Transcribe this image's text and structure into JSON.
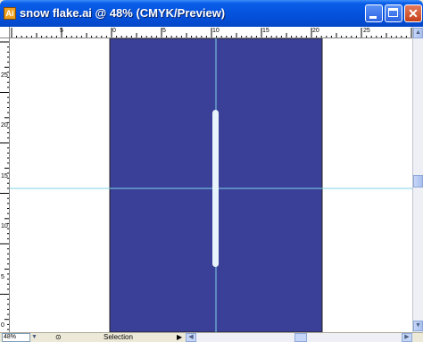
{
  "window": {
    "title": "snow flake.ai @ 48% (CMYK/Preview)",
    "app_icon_glyph": "Ai",
    "title_color": "#ffffff",
    "titlebar_color": "#0553df"
  },
  "rulers": {
    "horizontal_labels": [
      "5",
      "0",
      "5",
      "10",
      "15",
      "20",
      "25"
    ],
    "vertical_labels": [
      "25",
      "20",
      "15",
      "10",
      "5",
      "0"
    ]
  },
  "artboard": {
    "background_color": "#3a3f98",
    "guide_color": "#7fd3e6",
    "stroke_color": "#e8f4fb"
  },
  "statusbar": {
    "zoom_value": "48%",
    "zoom_arrow_icon": "chevron-down-icon",
    "status_icon": "magnifier-icon",
    "status_text": "Selection",
    "status_arrow_icon": "triangle-right-icon",
    "scroll_left_icon": "chevron-left-icon",
    "scroll_right_icon": "chevron-right-icon"
  },
  "scrollbar": {
    "up_icon": "chevron-up-icon",
    "down_icon": "chevron-down-icon"
  },
  "buttons": {
    "minimize_icon": "minimize-icon",
    "maximize_icon": "maximize-icon",
    "close_icon": "close-icon"
  }
}
